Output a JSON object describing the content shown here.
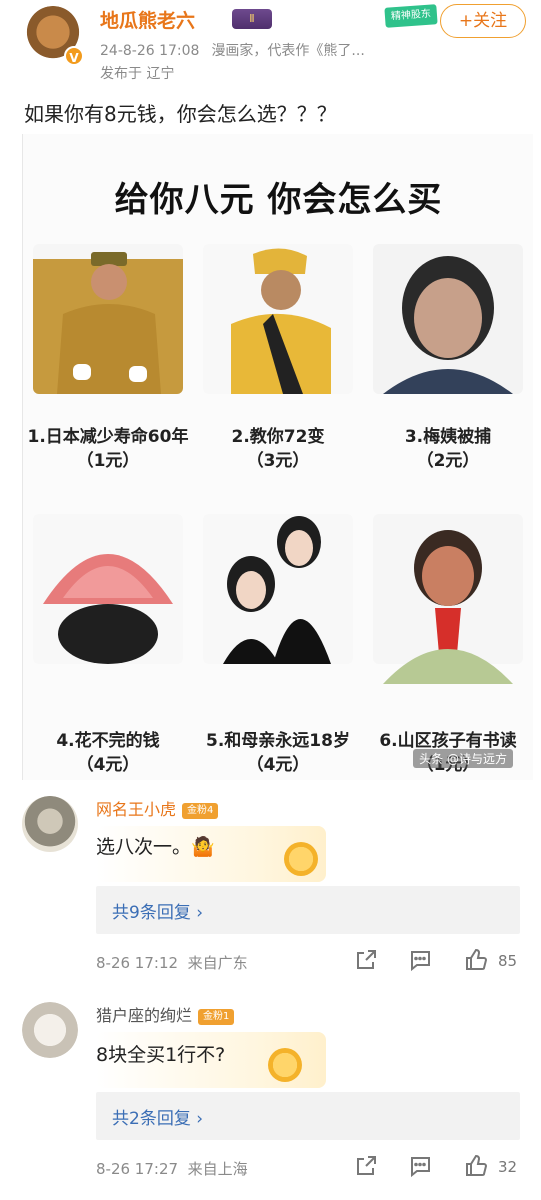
{
  "post": {
    "author": "地瓜熊老六",
    "level": "Ⅱ",
    "time": "24-8-26 17:08",
    "bio": "漫画家，代表作《熊了...",
    "location": "发布于 辽宁",
    "promo": "精神股东",
    "follow_label": "+关注",
    "text": "如果你有8元钱，你会怎么选？？？"
  },
  "meme": {
    "title": "给你八元 你会怎么买",
    "items": [
      {
        "caption": "1.日本减少寿命60年",
        "price": "（1元）"
      },
      {
        "caption": "2.教你72变",
        "price": "（3元）"
      },
      {
        "caption": "3.梅姨被捕",
        "price": "（2元）"
      },
      {
        "caption": "4.花不完的钱",
        "price": "（4元）"
      },
      {
        "caption": "5.和母亲永远18岁",
        "price": "（4元）"
      },
      {
        "caption": "6.山区孩子有书读",
        "price": "（1元）"
      }
    ],
    "watermark": "头条 @诗与远方"
  },
  "comments": [
    {
      "name": "网名王小虎",
      "fan_badge": "金粉4",
      "text": "选八次一。🤷",
      "replies": "共9条回复 ›",
      "date": "8-26 17:12",
      "from": "来自广东",
      "likes": "85",
      "name_color": "#e8761a"
    },
    {
      "name": "猎户座的绚烂",
      "fan_badge": "金粉1",
      "text": "8块全买1行不?",
      "replies": "共2条回复 ›",
      "date": "8-26 17:27",
      "from": "来自上海",
      "likes": "32",
      "name_color": "#555555"
    }
  ],
  "colors": {
    "accent": "#e8761a",
    "link": "#3b6eb5",
    "muted": "#8a8a8a"
  }
}
